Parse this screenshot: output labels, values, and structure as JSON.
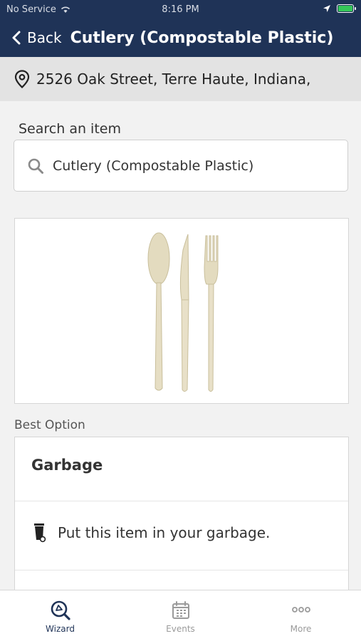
{
  "status_bar": {
    "carrier": "No Service",
    "time": "8:16 PM"
  },
  "nav": {
    "back_label": "Back",
    "title": "Cutlery (Compostable Plastic)"
  },
  "location": {
    "address": "2526 Oak Street, Terre Haute, Indiana,"
  },
  "search": {
    "label": "Search an item",
    "value": "Cutlery (Compostable Plastic)"
  },
  "item_image": {
    "icon": "cutlery-image"
  },
  "result": {
    "section_label": "Best Option",
    "title": "Garbage",
    "instruction": "Put this item in your garbage."
  },
  "tabs": [
    {
      "label": "Wizard",
      "icon": "wizard-search-icon",
      "active": true
    },
    {
      "label": "Events",
      "icon": "calendar-icon",
      "active": false
    },
    {
      "label": "More",
      "icon": "more-dots-icon",
      "active": false
    }
  ],
  "colors": {
    "header": "#1f3357",
    "tab_active": "#1f3357",
    "tab_inactive": "#9a9a9a"
  }
}
